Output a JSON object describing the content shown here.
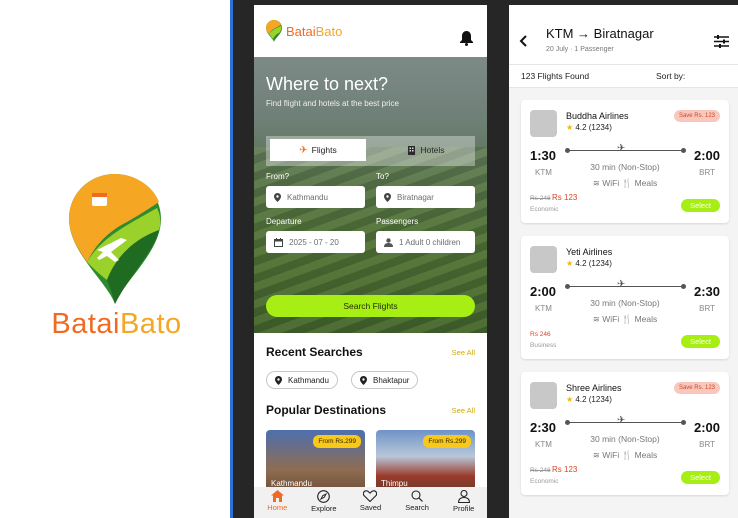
{
  "splash": {
    "brand_part1": "Batai",
    "brand_part2": "Bato"
  },
  "home": {
    "brand_part1": "Batai",
    "brand_part2": "Bato",
    "hero_title": "Where to next?",
    "hero_subtitle": "Find flight and hotels at the best price",
    "tabs": {
      "flights": "Flights",
      "hotels": "Hotels"
    },
    "form": {
      "from_label": "From?",
      "from_value": "Kathmandu",
      "to_label": "To?",
      "to_value": "Biratnagar",
      "departure_label": "Departure",
      "departure_value": "2025 - 07 - 20",
      "passengers_label": "Passengers",
      "passengers_value": "1 Adult 0 children",
      "search_button": "Search Flights"
    },
    "recent": {
      "title": "Recent Searches",
      "see_all": "See All",
      "items": [
        "Kathmandu",
        "Bhaktapur"
      ]
    },
    "popular": {
      "title": "Popular Destinations",
      "see_all": "See All",
      "items": [
        {
          "name": "Kathmandu",
          "price": "From Rs.299"
        },
        {
          "name": "Thimpu",
          "price": "From Rs.299"
        }
      ]
    },
    "nav": [
      "Home",
      "Explore",
      "Saved",
      "Search",
      "Profile"
    ]
  },
  "results": {
    "route": "KTM → Biratnagar",
    "subtitle": "20 July · 1 Passenger",
    "count": "123 Flights Found",
    "sort_label": "Sort by:",
    "flights": [
      {
        "airline": "Buddha Airlines",
        "rating": "4.2 (1234)",
        "save": "Save Rs. 123",
        "dep_time": "1:30",
        "dep_code": "KTM",
        "arr_time": "2:00",
        "arr_code": "BRT",
        "duration": "30 min (Non-Stop)",
        "wifi": "WiFi",
        "meals": "Meals",
        "old_price": "Rs 246",
        "price": "Rs 123",
        "cabin": "Economic",
        "select": "Select"
      },
      {
        "airline": "Yeti Airlines",
        "rating": "4.2 (1234)",
        "save": "",
        "dep_time": "2:00",
        "dep_code": "KTM",
        "arr_time": "2:30",
        "arr_code": "BRT",
        "duration": "30 min (Non-Stop)",
        "wifi": "WiFi",
        "meals": "Meals",
        "old_price": "",
        "price": "Rs 246",
        "cabin": "Business",
        "select": "Select"
      },
      {
        "airline": "Shree Airlines",
        "rating": "4.2 (1234)",
        "save": "Save Rs. 123",
        "dep_time": "2:30",
        "dep_code": "KTM",
        "arr_time": "2:00",
        "arr_code": "BRT",
        "duration": "30 min (Non-Stop)",
        "wifi": "WiFi",
        "meals": "Meals",
        "old_price": "Rs 246",
        "price": "Rs 123",
        "cabin": "Economic",
        "select": "Select"
      }
    ]
  },
  "colors": {
    "brand_orange": "#f26a21",
    "brand_yellow": "#f5a623",
    "brand_green": "#2e8a2e",
    "accent_lime": "#a6ee13",
    "price_red": "#d9452a",
    "divider_blue": "#2f6fd8"
  }
}
